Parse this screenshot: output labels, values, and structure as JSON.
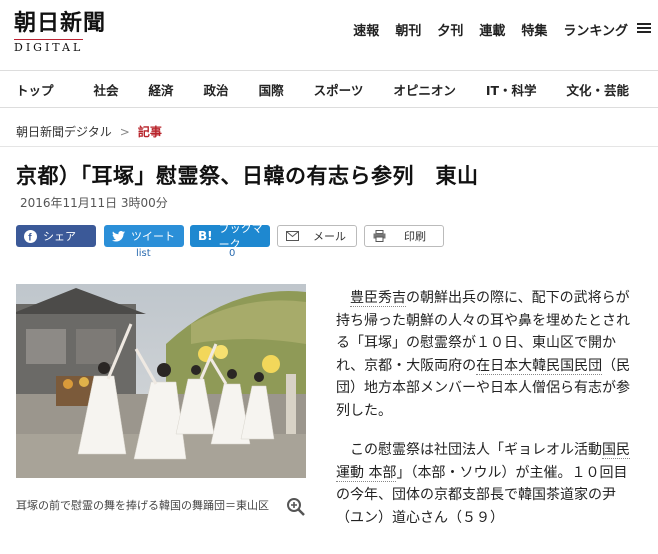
{
  "header": {
    "logo_main": "朝日新聞",
    "logo_sub": "DIGITAL",
    "top_links": [
      "速報",
      "朝刊",
      "夕刊",
      "連載",
      "特集",
      "ランキング"
    ]
  },
  "nav": {
    "items": [
      "トップ",
      "社会",
      "経済",
      "政治",
      "国際",
      "スポーツ",
      "オピニオン",
      "IT・科学",
      "文化・芸能"
    ]
  },
  "breadcrumb": {
    "root": "朝日新聞デジタル",
    "sep": ">",
    "current": "記事"
  },
  "article": {
    "title": "京都）「耳塚」慰霊祭、日韓の有志ら参列　東山",
    "date": "2016年11月11日 3時00分",
    "caption": "耳塚の前で慰霊の舞を捧げる韓国の舞踊団＝東山区",
    "p1_a": "豊臣秀吉",
    "p1_b": "の朝鮮出兵の際に、配下の武将らが持ち帰った朝鮮の人々の耳や鼻を埋めたとされる「耳塚」の慰霊祭が１０日、東山区で開かれ、京都・大阪両府の",
    "p1_c": "在日本大韓民国民団",
    "p1_d": "（民団）地方本部メンバーや日本人僧侶ら有志が参列した。",
    "p2_a": "この慰霊祭は社団法人「ギョレオル活動",
    "p2_b": "国民運動 本部",
    "p2_c": "」（本部・ソウル）が主催。１０回目の今年、団体の京都支部長で韓国茶道家の尹（ユン）道心さん（５９）"
  },
  "share": {
    "facebook": "シェア",
    "twitter": "ツイート",
    "hatena": "ブックマーク",
    "mail": "メール",
    "print": "印刷",
    "twitter_count": "list",
    "hatena_count": "0"
  },
  "colors": {
    "brand_red": "#b8232a",
    "facebook": "#3b5998",
    "twitter": "#2b8fd8",
    "hatena": "#1e88d0"
  }
}
